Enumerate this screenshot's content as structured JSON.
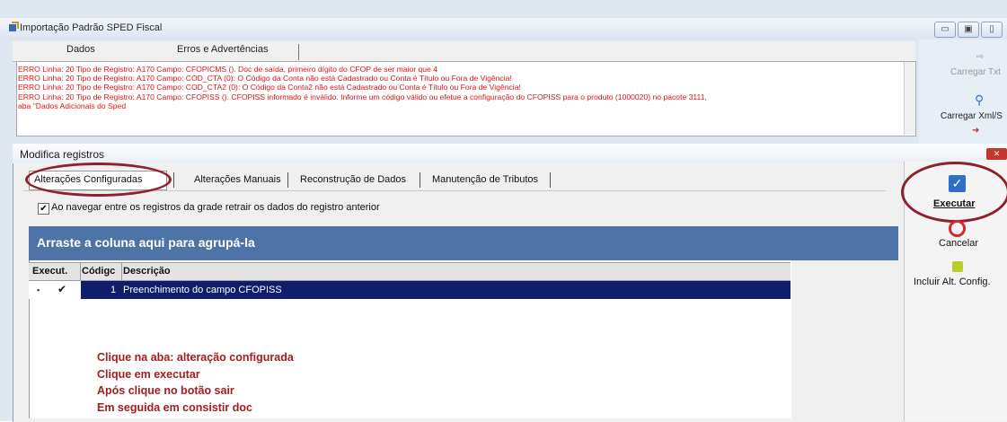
{
  "background_window": {
    "title": "Importação Padrão SPED Fiscal",
    "tabs": [
      "Dados",
      "Erros e Advertências"
    ],
    "errors": [
      "ERRO Linha: 20 Tipo de Registro: A170 Campo: CFOPICMS (). Doc de saída, primeiro dígito do CFOP de ser maior que 4",
      "ERRO Linha: 20 Tipo de Registro: A170 Campo: COD_CTA (0): O Código da Conta não está Cadastrado ou Conta é Título ou Fora de Vigência!",
      "ERRO Linha: 20 Tipo de Registro: A170 Campo: COD_CTA2 (0): O Código da Conta2 não está Cadastrado ou Conta é Título ou Fora de Vigência!",
      "ERRO Linha: 20 Tipo de Registro: A170 Campo: CFOPISS (). CFOPISS informado é inválido. Informe um código válido ou efetue a configuração do CFOPISS para o produto (1000020) no pacote 3111,",
      "aba \"Dados Adicionais do Sped"
    ],
    "side_items": [
      "Carregar Txt",
      "Carregar Xml/S"
    ]
  },
  "modal": {
    "title": "Modifica registros",
    "tabs": [
      "Alterações Configuradas",
      "Alterações Manuais",
      "Reconstrução de Dados",
      "Manutenção de Tributos"
    ],
    "checkbox_label": "Ao navegar entre os registros da grade retrair os dados do registro anterior",
    "checkbox_checked": true,
    "group_header": "Arraste a coluna aqui para agrupá-la",
    "grid": {
      "columns": [
        "Execut.",
        "Códigc",
        "Descrição"
      ],
      "rows": [
        {
          "execute": "✔",
          "code": "1",
          "description": "Preenchimento do campo CFOPISS"
        }
      ]
    },
    "instructions": [
      "Clique na aba: alteração configurada",
      "Clique em executar",
      "Após clique no botão sair",
      "Em seguida em consistir doc"
    ],
    "actions": {
      "execute": "Executar",
      "cancel": "Cancelar",
      "add": "Incluir Alt. Config."
    }
  },
  "colors": {
    "error_text": "#e01616",
    "group_header": "#4e73a6",
    "selected_row": "#0f1d6c",
    "annotation": "#a21d1d"
  }
}
